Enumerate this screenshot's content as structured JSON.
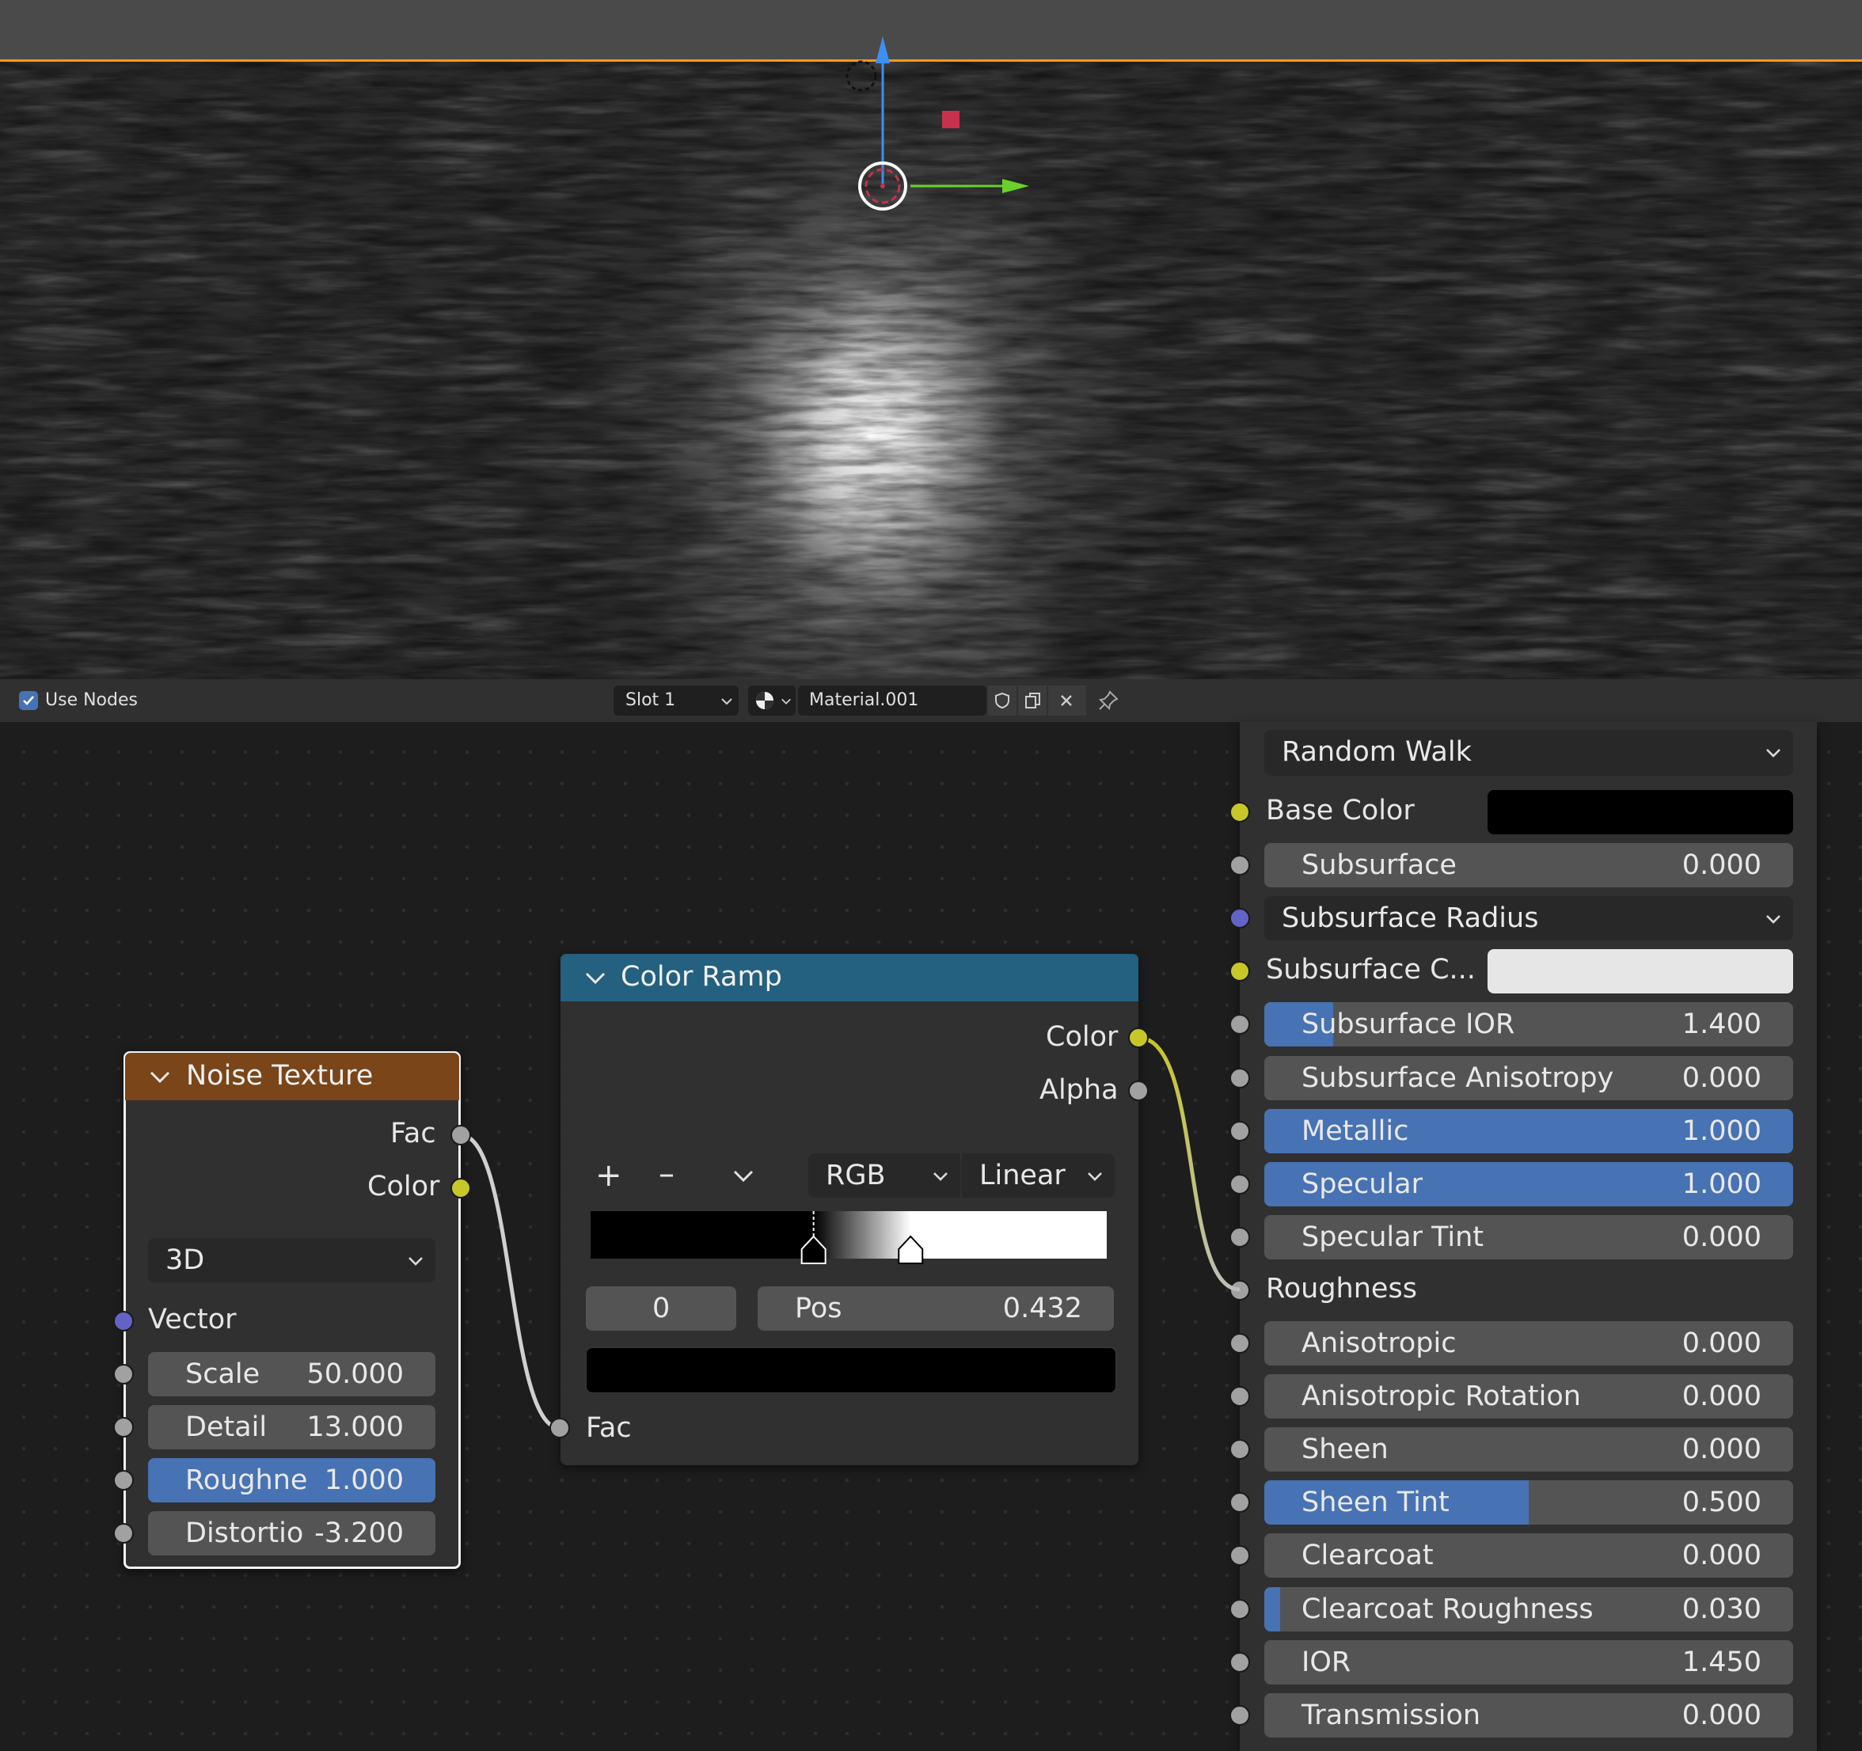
{
  "header": {
    "use_nodes_label": "Use Nodes",
    "use_nodes_checked": true,
    "slot_label": "Slot 1",
    "material_name": "Material.001",
    "icons": [
      "checkbox-icon",
      "sphere-material-icon",
      "shield-icon",
      "duplicate-icon",
      "close-icon",
      "pin-icon"
    ]
  },
  "noise_node": {
    "title": "Noise Texture",
    "header_color": "#7a4518",
    "outputs": [
      "Fac",
      "Color"
    ],
    "dimensions": "3D",
    "vector_label": "Vector",
    "fields": [
      {
        "label": "Scale",
        "value": "50.000",
        "fraction": 0
      },
      {
        "label": "Detail",
        "value": "13.000",
        "fraction": 0
      },
      {
        "label": "Roughne",
        "value": "1.000",
        "fraction": 1
      },
      {
        "label": "Distortio",
        "value": "-3.200",
        "fraction": 0
      }
    ]
  },
  "ramp_node": {
    "title": "Color Ramp",
    "header_color": "#24607f",
    "outputs": [
      "Color",
      "Alpha"
    ],
    "add_symbol": "+",
    "remove_symbol": "–",
    "color_mode": "RGB",
    "interpolation": "Linear",
    "stop_index": "0",
    "pos_label": "Pos",
    "pos_value": "0.432",
    "input_label": "Fac",
    "stops": [
      0.432,
      0.62
    ],
    "stop_color": "#000000"
  },
  "bsdf_panel": {
    "subsurface_method": "Random Walk",
    "rows": [
      {
        "label": "Base Color",
        "kind": "color",
        "color": "#000000",
        "socket": "yellow"
      },
      {
        "label": "Subsurface",
        "kind": "value",
        "value": "0.000",
        "fraction": 0,
        "socket": "grey"
      },
      {
        "label": "Subsurface Radius",
        "kind": "dropdown",
        "socket": "purple"
      },
      {
        "label": "Subsurface C...",
        "kind": "color",
        "color": "#e6e6e6",
        "socket": "yellow"
      },
      {
        "label": "Subsurface IOR",
        "kind": "value",
        "value": "1.400",
        "fraction": 0.13,
        "socket": "grey"
      },
      {
        "label": "Subsurface Anisotropy",
        "kind": "value",
        "value": "0.000",
        "fraction": 0,
        "socket": "grey"
      },
      {
        "label": "Metallic",
        "kind": "value",
        "value": "1.000",
        "fraction": 1,
        "socket": "grey"
      },
      {
        "label": "Specular",
        "kind": "value",
        "value": "1.000",
        "fraction": 1,
        "socket": "grey"
      },
      {
        "label": "Specular Tint",
        "kind": "value",
        "value": "0.000",
        "fraction": 0,
        "socket": "grey"
      },
      {
        "label": "Roughness",
        "kind": "label",
        "socket": "grey"
      },
      {
        "label": "Anisotropic",
        "kind": "value",
        "value": "0.000",
        "fraction": 0,
        "socket": "grey"
      },
      {
        "label": "Anisotropic Rotation",
        "kind": "value",
        "value": "0.000",
        "fraction": 0,
        "socket": "grey"
      },
      {
        "label": "Sheen",
        "kind": "value",
        "value": "0.000",
        "fraction": 0,
        "socket": "grey"
      },
      {
        "label": "Sheen Tint",
        "kind": "value",
        "value": "0.500",
        "fraction": 0.5,
        "socket": "grey"
      },
      {
        "label": "Clearcoat",
        "kind": "value",
        "value": "0.000",
        "fraction": 0,
        "socket": "grey"
      },
      {
        "label": "Clearcoat Roughness",
        "kind": "value",
        "value": "0.030",
        "fraction": 0.03,
        "socket": "grey"
      },
      {
        "label": "IOR",
        "kind": "value",
        "value": "1.450",
        "fraction": 0,
        "socket": "grey"
      },
      {
        "label": "Transmission",
        "kind": "value",
        "value": "0.000",
        "fraction": 0,
        "socket": "grey"
      }
    ]
  },
  "colors": {
    "accent": "#4772b3",
    "horizon": "#f29a1c",
    "link_grey": "#cfcfcf",
    "link_yellow": "#c7c729"
  }
}
